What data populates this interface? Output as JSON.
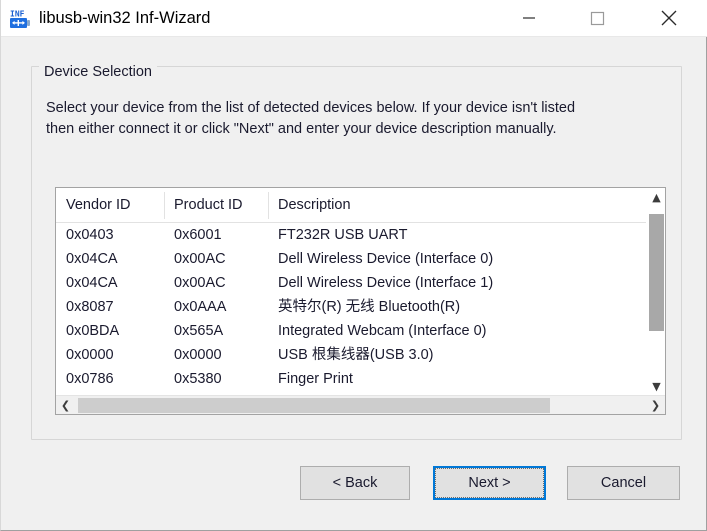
{
  "window": {
    "title": "libusb-win32 Inf-Wizard",
    "icon": "inf-usb-icon",
    "controls": [
      {
        "name": "minimize-button",
        "glyph": "minimize-icon"
      },
      {
        "name": "maximize-button",
        "glyph": "maximize-icon"
      },
      {
        "name": "close-button",
        "glyph": "close-icon"
      }
    ]
  },
  "groupbox": {
    "legend": "Device Selection"
  },
  "instructions": {
    "line1": "Select your device from the list of detected devices below. If your device isn't listed",
    "line2": "then either connect it or click \"Next\" and enter your device description manually."
  },
  "listview": {
    "columns": [
      "Vendor ID",
      "Product ID",
      "Description"
    ],
    "rows": [
      {
        "vendor": "0x0403",
        "product": "0x6001",
        "description": "FT232R USB UART"
      },
      {
        "vendor": "0x04CA",
        "product": "0x00AC",
        "description": "Dell Wireless Device (Interface 0)"
      },
      {
        "vendor": "0x04CA",
        "product": "0x00AC",
        "description": "Dell Wireless Device (Interface 1)"
      },
      {
        "vendor": "0x8087",
        "product": "0x0AAA",
        "description": "英特尔(R) 无线 Bluetooth(R)"
      },
      {
        "vendor": "0x0BDA",
        "product": "0x565A",
        "description": "Integrated Webcam (Interface 0)"
      },
      {
        "vendor": "0x0000",
        "product": "0x0000",
        "description": "USB 根集线器(USB 3.0)"
      },
      {
        "vendor": "0x0786",
        "product": "0x5380",
        "description": "Finger Print"
      }
    ],
    "vertical_scrollbar": {
      "up_arrow": "chevron-up-icon",
      "down_arrow": "chevron-down-icon"
    },
    "horizontal_scrollbar": {
      "left_arrow": "chevron-left-icon",
      "right_arrow": "chevron-right-icon"
    }
  },
  "buttons": {
    "back": "< Back",
    "next": "Next >",
    "cancel": "Cancel"
  },
  "colors": {
    "focus_accent": "#0078d7",
    "dialog_background": "#f0f0f0",
    "button_face": "#e1e1e1",
    "scroll_thumb": "#a8a8a8"
  }
}
